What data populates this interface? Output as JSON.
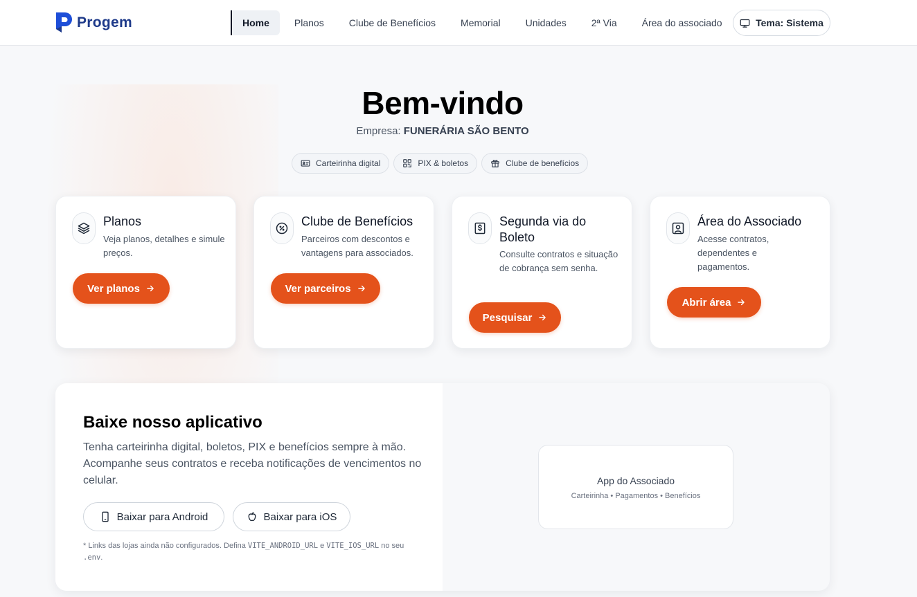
{
  "brand": {
    "name": "Progem",
    "color": "#1e3a8a"
  },
  "nav": {
    "items": [
      {
        "label": "Home",
        "active": true
      },
      {
        "label": "Planos"
      },
      {
        "label": "Clube de Benefícios"
      },
      {
        "label": "Memorial"
      },
      {
        "label": "Unidades"
      },
      {
        "label": "2ª Via"
      },
      {
        "label": "Área do associado"
      }
    ],
    "theme_label": "Tema: Sistema",
    "theme_icon": "monitor-icon"
  },
  "hero": {
    "title": "Bem-vindo",
    "company_prefix": "Empresa:",
    "company_name": "FUNERÁRIA SÃO BENTO",
    "chips": [
      {
        "label": "Carteirinha digital",
        "icon": "id-card-icon"
      },
      {
        "label": "PIX & boletos",
        "icon": "qr-code-icon"
      },
      {
        "label": "Clube de benefícios",
        "icon": "gift-icon"
      }
    ]
  },
  "cards": [
    {
      "title": "Planos",
      "desc": "Veja planos, detalhes e simule preços.",
      "cta": "Ver planos",
      "icon": "layers-icon"
    },
    {
      "title": "Clube de Benefícios",
      "desc": "Parceiros com descontos e vantagens para associados.",
      "cta": "Ver parceiros",
      "icon": "discount-badge-icon"
    },
    {
      "title": "Segunda via do Boleto",
      "desc": "Consulte contratos e situação de cobrança sem senha.",
      "cta": "Pesquisar",
      "icon": "receipt-icon"
    },
    {
      "title": "Área do Associado",
      "desc": "Acesse contratos, dependentes e pagamentos.",
      "cta": "Abrir área",
      "icon": "user-square-icon"
    }
  ],
  "app": {
    "title": "Baixe nosso aplicativo",
    "desc": "Tenha carteirinha digital, boletos, PIX e benefícios sempre à mão. Acompanhe seus contratos e receba notificações de vencimentos no celular.",
    "android_label": "Baixar para Android",
    "ios_label": "Baixar para iOS",
    "note_prefix": "* Links das lojas ainda não configurados. Defina",
    "note_var1": "VITE_ANDROID_URL",
    "note_and": "e",
    "note_var2": "VITE_IOS_URL",
    "note_mid": "no seu",
    "note_file": ".env",
    "note_end": ".",
    "preview_title": "App do Associado",
    "preview_sub": "Carteirinha • Pagamentos • Benefícios"
  },
  "colors": {
    "accent": "#e4521b",
    "background": "#f7f8fa"
  }
}
